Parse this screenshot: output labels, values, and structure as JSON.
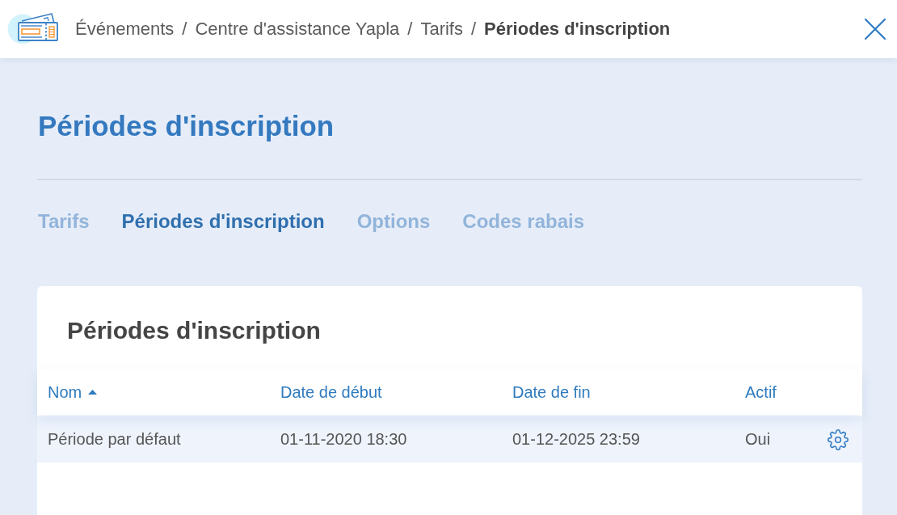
{
  "header": {
    "breadcrumb": [
      {
        "label": "Événements",
        "current": false
      },
      {
        "separator": "/",
        "label": "Centre d'assistance Yapla",
        "current": false
      },
      {
        "separator": "/",
        "label": "Tarifs",
        "current": false
      },
      {
        "separator": "/",
        "label": "Périodes d'inscription",
        "current": true
      }
    ]
  },
  "page_title": "Périodes d'inscription",
  "tabs": [
    {
      "label": "Tarifs",
      "selected": false
    },
    {
      "label": "Périodes d'inscription",
      "selected": true
    },
    {
      "label": "Options",
      "selected": false
    },
    {
      "label": "Codes rabais",
      "selected": false
    }
  ],
  "card": {
    "title": "Périodes d'inscription",
    "table": {
      "columns": [
        {
          "label": "Nom",
          "sorted": true
        },
        {
          "label": "Date de début",
          "sorted": false
        },
        {
          "label": "Date de fin",
          "sorted": false
        },
        {
          "label": "Actif",
          "sorted": false
        }
      ],
      "rows": [
        {
          "cells": [
            "Période par défaut",
            "01-11-2020 18:30",
            "01-12-2025 23:59",
            "Oui"
          ]
        }
      ]
    }
  }
}
